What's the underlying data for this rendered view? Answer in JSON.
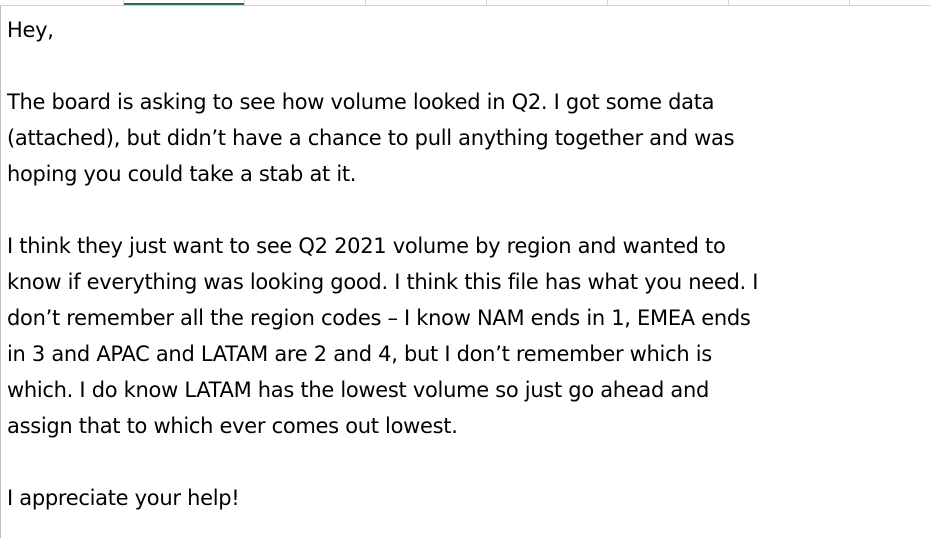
{
  "spreadsheet": {
    "cell_text": {
      "greeting": "Hey,",
      "para1": [
        "The board is asking to see how volume looked in Q2. I got some data",
        "(attached), but didn’t have a chance to pull anything together and was",
        "hoping you could take a stab at it."
      ],
      "para2": [
        "I think they just want to see Q2 2021 volume by region and wanted to",
        "know if everything was looking good. I think this file has what you need. I",
        "don’t remember all the region codes – I know NAM ends in 1, EMEA ends",
        "in 3 and APAC and LATAM are 2 and 4, but I don’t remember which is",
        "which. I do know LATAM has the lowest volume so just go ahead and",
        "assign that to which ever comes out lowest."
      ],
      "closing": "I appreciate your help!"
    },
    "colors": {
      "selected_column_accent": "#217346",
      "gridline": "#d4d4d4"
    }
  }
}
